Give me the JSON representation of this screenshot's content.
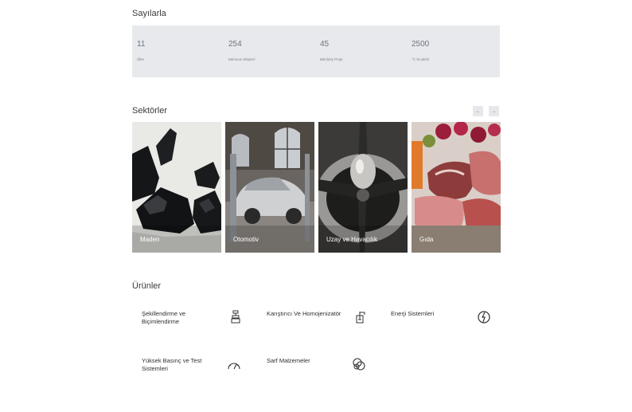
{
  "stats": {
    "title": "Sayılarla",
    "items": [
      {
        "value": "11",
        "label": "Ülke"
      },
      {
        "value": "254",
        "label": "Memnun Müşteri"
      },
      {
        "value": "45",
        "label": "Bitirilmiş Proje"
      },
      {
        "value": "2500",
        "label": "°C Sıcaklık"
      }
    ]
  },
  "sectors": {
    "title": "Sektörler",
    "prev_icon": "arrow-left-icon",
    "next_icon": "arrow-right-icon",
    "prev_label": "←",
    "next_label": "→",
    "cards": [
      {
        "label": "Maden"
      },
      {
        "label": "Otomotiv"
      },
      {
        "label": "Uzay ve Havacılık"
      },
      {
        "label": "Gıda"
      }
    ]
  },
  "products": {
    "title": "Ürünler",
    "arrow": "→",
    "items": [
      {
        "name": "Şekillendirme ve Biçimlendirme",
        "icon": "press-machine-icon"
      },
      {
        "name": "Karıştırıcı Ve Homojenizatör",
        "icon": "mixer-icon"
      },
      {
        "name": "Enerji Sistemleri",
        "icon": "energy-icon"
      },
      {
        "name": "Yüksek Basınç ve Test Sistemleri",
        "icon": "gauge-icon"
      },
      {
        "name": "Sarf Malzemeler",
        "icon": "consumables-icon"
      }
    ]
  },
  "colors": {
    "stats_bg": "#e8e9ec",
    "accent_arrow": "#d6b84a"
  }
}
